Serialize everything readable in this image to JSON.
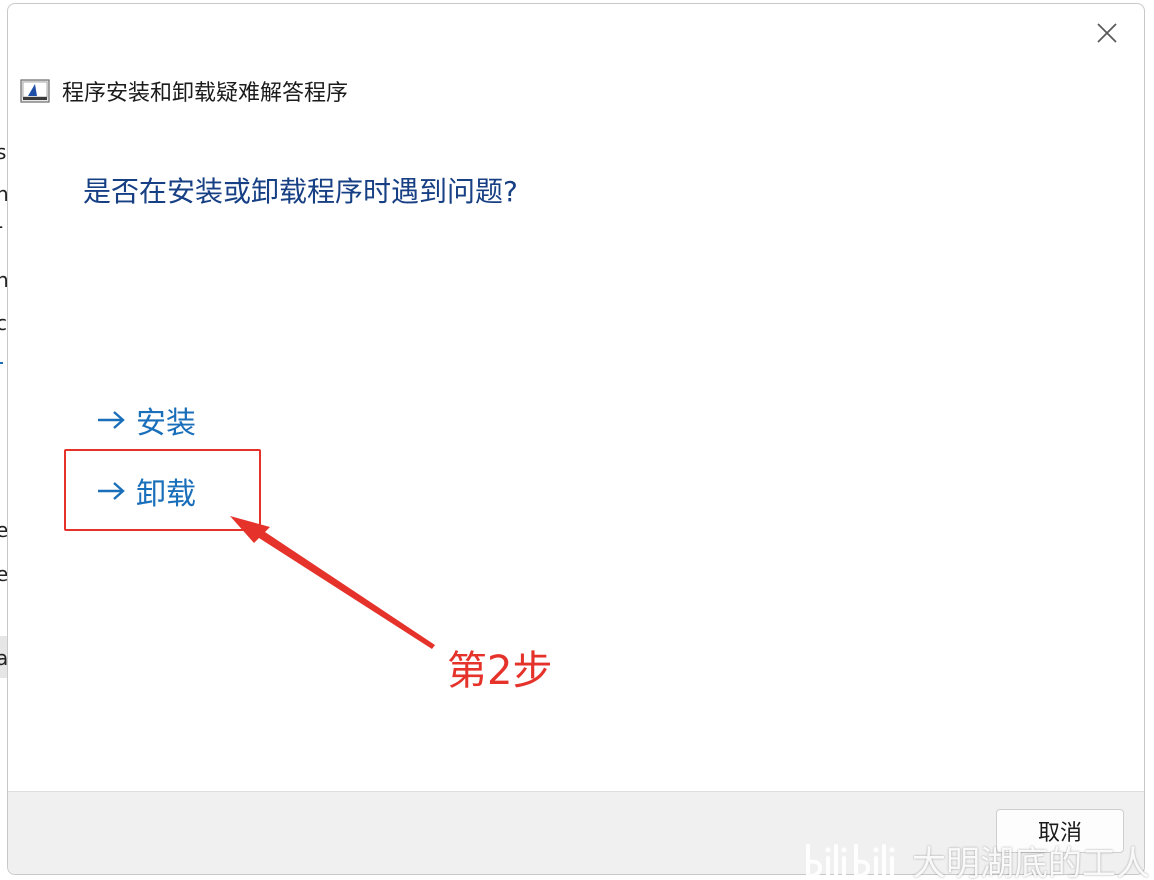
{
  "window": {
    "title": "程序安装和卸载疑难解答程序",
    "close_icon": "close-icon"
  },
  "main": {
    "question": "是否在安装或卸载程序时遇到问题?",
    "options": [
      {
        "label": "安装",
        "icon": "arrow-right-icon"
      },
      {
        "label": "卸载",
        "icon": "arrow-right-icon"
      }
    ]
  },
  "annotation": {
    "step_label": "第2步",
    "color": "#e5322a"
  },
  "footer": {
    "cancel_label": "取消"
  },
  "watermark": {
    "text": "大明湖底的工人"
  },
  "background": {
    "fragments": [
      "s",
      "n",
      "-",
      "n",
      "c",
      "e",
      "e",
      "a"
    ]
  },
  "colors": {
    "heading": "#173f84",
    "link": "#1a6fba",
    "footer_bg": "#f0f0f0"
  }
}
